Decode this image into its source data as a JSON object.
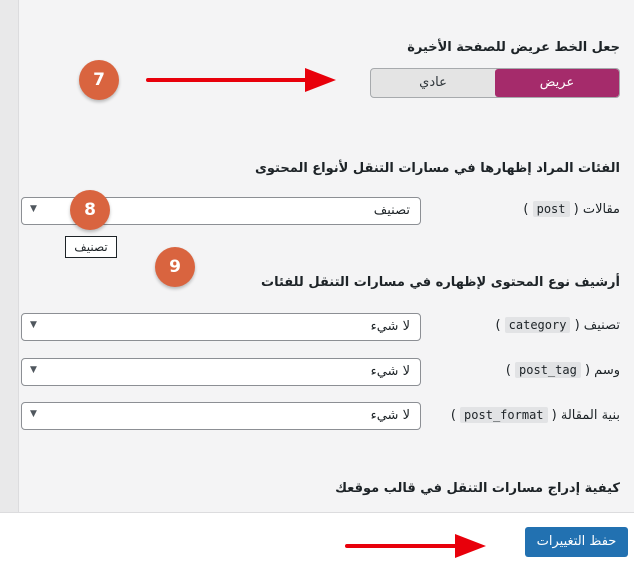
{
  "bold_last_page": {
    "heading": "جعل الخط عريض للصفحة الأخيرة",
    "options": [
      "عريض",
      "عادي"
    ],
    "selected": "عريض"
  },
  "taxonomies_section": {
    "heading": "الفئات المراد إظهارها في مسارات التنقل لأنواع المحتوى",
    "post_row": {
      "label": "مقالات",
      "slug": "post",
      "value": "تصنيف"
    },
    "tooltip": "تصنيف"
  },
  "archive_section": {
    "heading": "أرشيف نوع المحتوى لإظهاره في مسارات التنقل للفئات",
    "rows": [
      {
        "label": "تصنيف",
        "slug": "category",
        "value": "لا شيء"
      },
      {
        "label": "وسم",
        "slug": "post_tag",
        "value": "لا شيء"
      },
      {
        "label": "بنية المقالة",
        "slug": "post_format",
        "value": "لا شيء"
      }
    ]
  },
  "insert_section": {
    "heading": "كيفية إدراج مسارات التنقل في قالب موقعك"
  },
  "save_button": "حفظ التغييرات",
  "annotations": {
    "badge_7": "7",
    "badge_8": "8",
    "badge_9": "9"
  },
  "colors": {
    "accent": "#a52b6b",
    "button": "#2271b1",
    "badge": "#d9643f",
    "arrow": "#e8000b"
  }
}
